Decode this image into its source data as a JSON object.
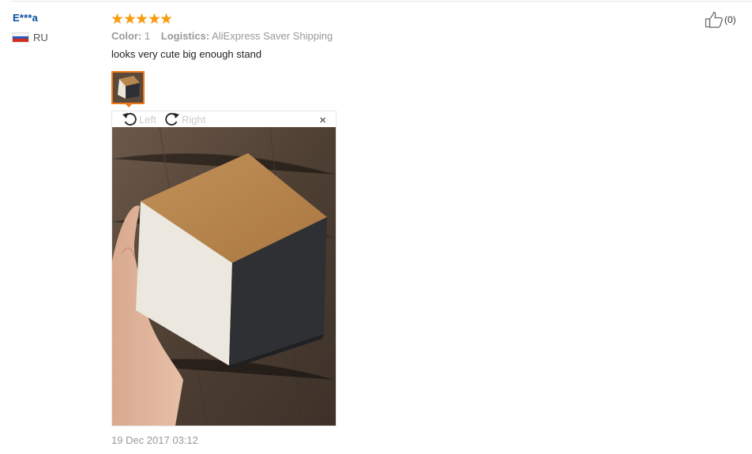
{
  "user": {
    "name": "E***a",
    "country": "RU"
  },
  "review": {
    "rating": 5,
    "props": [
      {
        "key": "Color:",
        "value": "1"
      },
      {
        "key": "Logistics:",
        "value": "AliExpress Saver Shipping"
      }
    ],
    "text": "looks very cute big enough stand",
    "date": "19 Dec 2017 03:12"
  },
  "viewer": {
    "rotate_left_label": "Left",
    "rotate_right_label": "Right",
    "close_label": "×"
  },
  "useful": {
    "count_label": "(0)"
  },
  "colors": {
    "star": "#f79c0f",
    "thumb_border": "#f07a15",
    "username": "#0a4f9e"
  },
  "icons": [
    "ru-flag-icon",
    "star-icon",
    "rotate-left-icon",
    "rotate-right-icon",
    "close-icon",
    "thumbs-up-icon"
  ]
}
